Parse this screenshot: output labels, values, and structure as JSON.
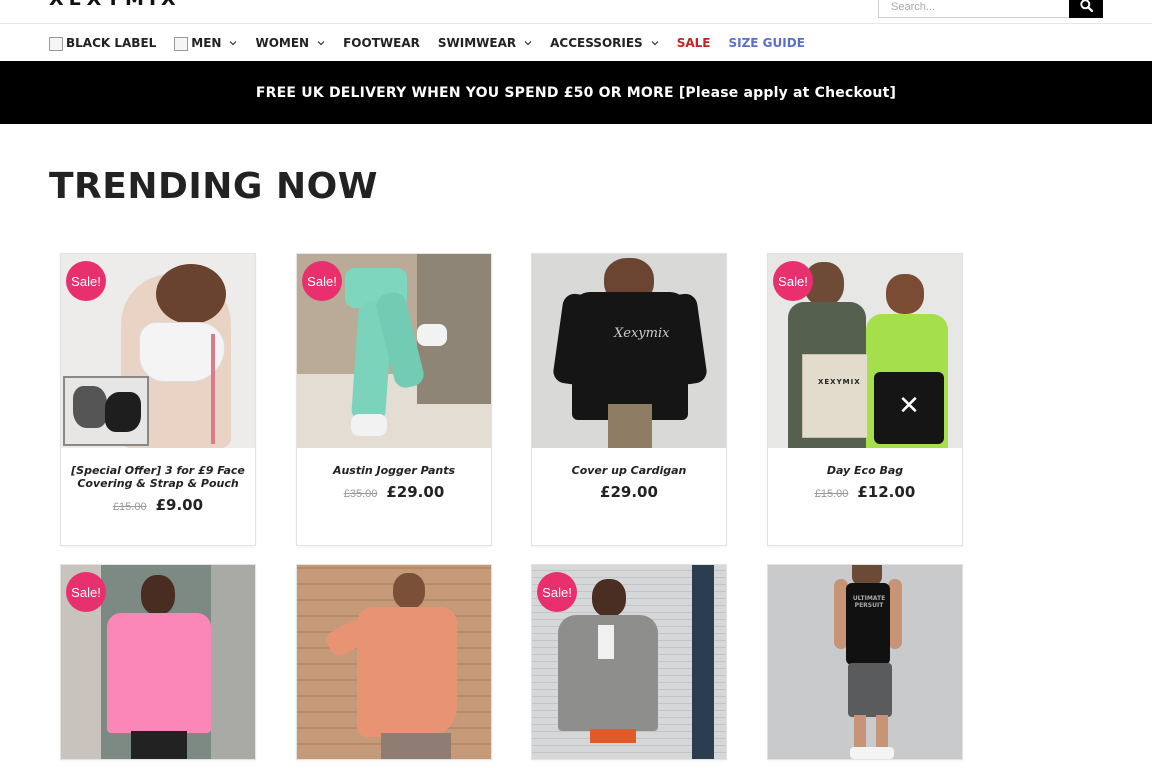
{
  "header": {
    "logo_text": "XEXYMIX",
    "search_placeholder": "Search..."
  },
  "nav": {
    "items": [
      {
        "label": "BLACK LABEL",
        "has_image": true,
        "has_dropdown": false
      },
      {
        "label": "MEN",
        "has_image": true,
        "has_dropdown": true
      },
      {
        "label": "WOMEN",
        "has_image": false,
        "has_dropdown": true
      },
      {
        "label": "FOOTWEAR",
        "has_image": false,
        "has_dropdown": false
      },
      {
        "label": "SWIMWEAR",
        "has_image": false,
        "has_dropdown": true
      },
      {
        "label": "ACCESSORIES",
        "has_image": false,
        "has_dropdown": true
      },
      {
        "label": "SALE",
        "has_image": false,
        "has_dropdown": false
      },
      {
        "label": "SIZE GUIDE",
        "has_image": false,
        "has_dropdown": false
      }
    ],
    "sale_color": "#cc1f1f",
    "guide_color": "#5b6fc9"
  },
  "banner": {
    "text": "FREE UK DELIVERY WHEN YOU SPEND £50 OR MORE [Please apply at Checkout]"
  },
  "section": {
    "title": "TRENDING NOW"
  },
  "products": [
    {
      "name": "[Special Offer] 3 for £9 Face Covering & Strap & Pouch",
      "old_price": "£15.00",
      "price": "£9.00",
      "sale": true,
      "sale_label": "Sale!",
      "image": "face-mask-photo"
    },
    {
      "name": "Austin Jogger Pants",
      "old_price": "£35.00",
      "price": "£29.00",
      "sale": true,
      "sale_label": "Sale!",
      "image": "jogger-pants-photo"
    },
    {
      "name": "Cover up Cardigan",
      "old_price": "",
      "price": "£29.00",
      "sale": false,
      "sale_label": "",
      "image": "cardigan-photo"
    },
    {
      "name": "Day Eco Bag",
      "old_price": "£15.00",
      "price": "£12.00",
      "sale": true,
      "sale_label": "Sale!",
      "image": "eco-bag-photo"
    },
    {
      "name": "",
      "old_price": "",
      "price": "",
      "sale": true,
      "sale_label": "Sale!",
      "image": "pink-tshirt-photo"
    },
    {
      "name": "",
      "old_price": "",
      "price": "",
      "sale": false,
      "sale_label": "",
      "image": "orange-top-photo"
    },
    {
      "name": "",
      "old_price": "",
      "price": "",
      "sale": true,
      "sale_label": "Sale!",
      "image": "grey-polo-photo"
    },
    {
      "name": "",
      "old_price": "",
      "price": "",
      "sale": false,
      "sale_label": "",
      "image": "tank-top-photo"
    }
  ],
  "colors": {
    "accent_sale_badge": "#e8306f",
    "banner_bg": "#000000"
  }
}
